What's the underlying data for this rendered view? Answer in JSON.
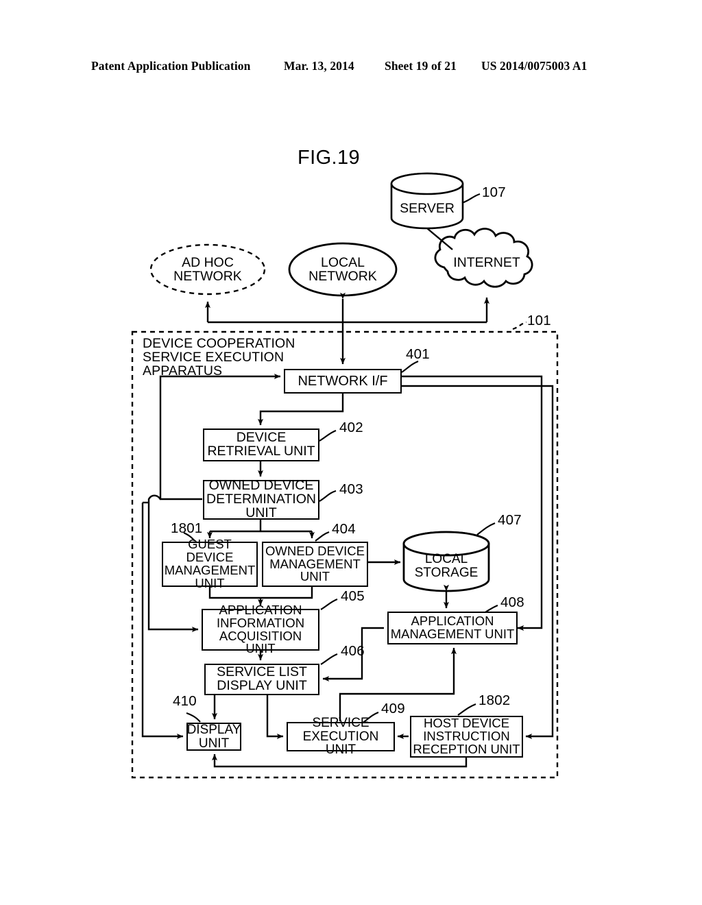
{
  "header": {
    "publication": "Patent Application Publication",
    "date": "Mar. 13, 2014",
    "sheet": "Sheet 19 of 21",
    "patent_number": "US 2014/0075003 A1"
  },
  "figure": {
    "title": "FIG.19"
  },
  "apparatus": {
    "caption": "DEVICE COOPERATION\nSERVICE EXECUTION\nAPPARATUS",
    "ref": "101"
  },
  "external": {
    "server": {
      "label": "SERVER",
      "ref": "107",
      "shape": "cylinder"
    },
    "ad_hoc_network": {
      "label": "AD HOC\nNETWORK",
      "shape": "dashed-ellipse"
    },
    "local_network": {
      "label": "LOCAL\nNETWORK",
      "shape": "ellipse"
    },
    "internet": {
      "label": "INTERNET",
      "shape": "cloud"
    }
  },
  "blocks": [
    {
      "id": "network_if",
      "label": "NETWORK I/F",
      "ref": "401",
      "shape": "rect"
    },
    {
      "id": "device_retrieval",
      "label": "DEVICE\nRETRIEVAL UNIT",
      "ref": "402",
      "shape": "rect"
    },
    {
      "id": "owned_determination",
      "label": "OWNED DEVICE\nDETERMINATION\nUNIT",
      "ref": "403",
      "shape": "rect"
    },
    {
      "id": "guest_management",
      "label": "GUEST DEVICE\nMANAGEMENT\nUNIT",
      "ref": "1801",
      "shape": "rect"
    },
    {
      "id": "owned_management",
      "label": "OWNED DEVICE\nMANAGEMENT\nUNIT",
      "ref": "404",
      "shape": "rect"
    },
    {
      "id": "local_storage",
      "label": "LOCAL\nSTORAGE",
      "ref": "407",
      "shape": "cylinder"
    },
    {
      "id": "app_info_acq",
      "label": "APPLICATION\nINFORMATION\nACQUISITION UNIT",
      "ref": "405",
      "shape": "rect"
    },
    {
      "id": "app_management",
      "label": "APPLICATION\nMANAGEMENT UNIT",
      "ref": "408",
      "shape": "rect"
    },
    {
      "id": "service_list",
      "label": "SERVICE LIST\nDISPLAY UNIT",
      "ref": "406",
      "shape": "rect"
    },
    {
      "id": "display_unit",
      "label": "DISPLAY\nUNIT",
      "ref": "410",
      "shape": "rect"
    },
    {
      "id": "service_execution",
      "label": "SERVICE\nEXECUTION UNIT",
      "ref": "409",
      "shape": "rect"
    },
    {
      "id": "host_instruction",
      "label": "HOST DEVICE\nINSTRUCTION\nRECEPTION UNIT",
      "ref": "1802",
      "shape": "rect"
    }
  ],
  "colors": {
    "ink": "#000000",
    "paper": "#ffffff"
  }
}
